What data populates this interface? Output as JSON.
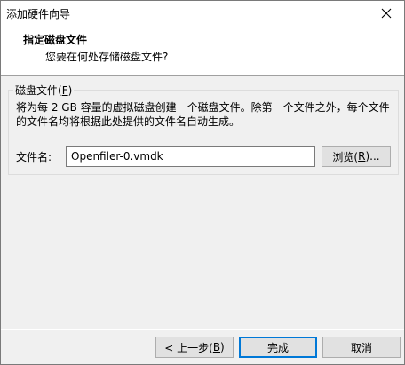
{
  "window": {
    "title": "添加硬件向导"
  },
  "header": {
    "title": "指定磁盘文件",
    "subtitle": "您要在何处存储磁盘文件?"
  },
  "group": {
    "legend_text": "磁盘文件(",
    "legend_mnemonic": "F",
    "legend_end": ")",
    "description": "将为每 2 GB 容量的虚拟磁盘创建一个磁盘文件。除第一个文件之外，每个文件的文件名均将根据此处提供的文件名自动生成。"
  },
  "file_name": {
    "label": "文件名:",
    "value": "Openfiler-0.vmdk"
  },
  "buttons": {
    "browse_text": "浏览(",
    "browse_mnemonic": "R",
    "browse_end": ")...",
    "back_text": "< 上一步(",
    "back_mnemonic": "B",
    "back_end": ")",
    "finish": "完成",
    "cancel": "取消"
  },
  "colors": {
    "dialog_bg": "#f0f0f0",
    "header_bg": "#ffffff",
    "button_bg": "#e1e1e1",
    "default_button_border": "#0078d7"
  }
}
